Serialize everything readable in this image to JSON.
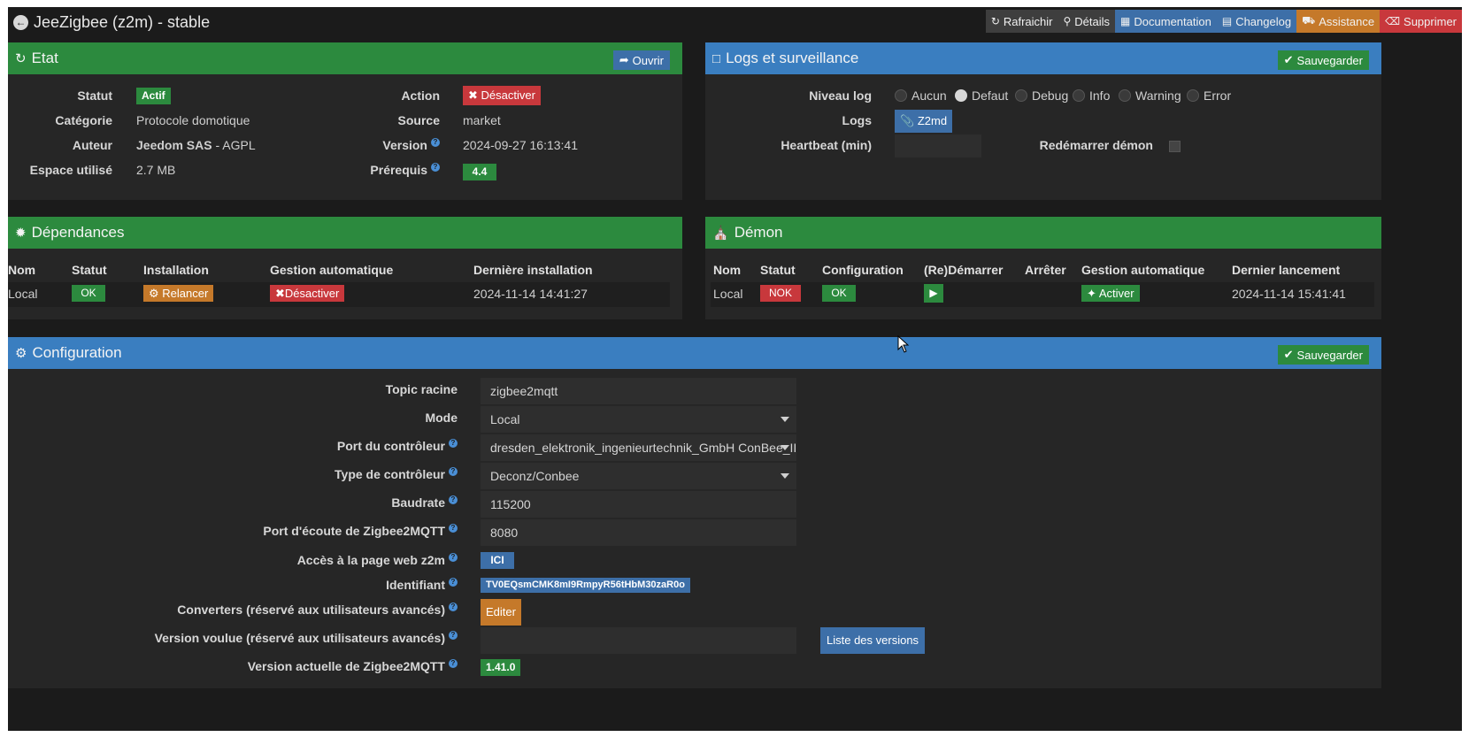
{
  "app": {
    "title": "JeeZigbee (z2m) - stable"
  },
  "top_actions": [
    {
      "label": "Rafraichir",
      "icon": "refresh-icon"
    },
    {
      "label": "Détails",
      "icon": "search-icon"
    },
    {
      "label": "Documentation",
      "icon": "book-icon"
    },
    {
      "label": "Changelog",
      "icon": "file-icon"
    },
    {
      "label": "Assistance",
      "icon": "truck-icon"
    },
    {
      "label": "Supprimer",
      "icon": "trash-icon"
    }
  ],
  "etat": {
    "title": "Etat",
    "open_button": "Ouvrir",
    "statut_label": "Statut",
    "statut_value": "Actif",
    "categorie_label": "Catégorie",
    "categorie_value": "Protocole domotique",
    "auteur_label": "Auteur",
    "auteur_value": "Jeedom SAS",
    "auteur_license": " - AGPL",
    "espace_label": "Espace utilisé",
    "espace_value": "2.7 MB",
    "action_label": "Action",
    "action_button": "Désactiver",
    "source_label": "Source",
    "source_value": "market",
    "version_label": "Version",
    "version_value": "2024-09-27 16:13:41",
    "prerequis_label": "Prérequis",
    "prerequis_value": "4.4"
  },
  "logs": {
    "title": "Logs et surveillance",
    "save_button": "Sauvegarder",
    "niveau_label": "Niveau log",
    "levels": [
      "Aucun",
      "Defaut",
      "Debug",
      "Info",
      "Warning",
      "Error"
    ],
    "selected_level": "Defaut",
    "logs_label": "Logs",
    "logs_button": "Z2md",
    "heartbeat_label": "Heartbeat (min)",
    "heartbeat_value": "",
    "restart_label": "Redémarrer démon"
  },
  "dependances": {
    "title": "Dépendances",
    "headers": [
      "Nom",
      "Statut",
      "Installation",
      "Gestion automatique",
      "Dernière installation"
    ],
    "row": {
      "nom": "Local",
      "statut": "OK",
      "installation": "Relancer",
      "gestion": "Désactiver",
      "derniere": "2024-11-14 14:41:27"
    }
  },
  "demon": {
    "title": "Démon",
    "headers": [
      "Nom",
      "Statut",
      "Configuration",
      "(Re)Démarrer",
      "Arrêter",
      "Gestion automatique",
      "Dernier lancement"
    ],
    "row": {
      "nom": "Local",
      "statut": "NOK",
      "configuration": "OK",
      "gestion": "Activer",
      "dernier": "2024-11-14 15:41:41"
    }
  },
  "configuration": {
    "title": "Configuration",
    "save_button": "Sauvegarder",
    "topic_label": "Topic racine",
    "topic_value": "zigbee2mqtt",
    "mode_label": "Mode",
    "mode_value": "Local",
    "port_label": "Port du contrôleur",
    "port_value": "dresden_elektronik_ingenieurtechnik_GmbH ConBee_II",
    "type_label": "Type de contrôleur",
    "type_value": "Deconz/Conbee",
    "baud_label": "Baudrate",
    "baud_value": "115200",
    "ecoute_label": "Port d'écoute de Zigbee2MQTT",
    "ecoute_value": "8080",
    "acces_label": "Accès à la page web z2m",
    "acces_button": "ICI",
    "ident_label": "Identifiant",
    "ident_value": "TV0EQsmCMK8mI9RmpyR56tHbM30zaR0o",
    "conv_label": "Converters (réservé aux utilisateurs avancés)",
    "conv_button": "Editer",
    "voulue_label": "Version voulue (réservé aux utilisateurs avancés)",
    "voulue_value": "",
    "versions_button": "Liste des versions",
    "actuelle_label": "Version actuelle de Zigbee2MQTT",
    "actuelle_value": "1.41.0"
  }
}
